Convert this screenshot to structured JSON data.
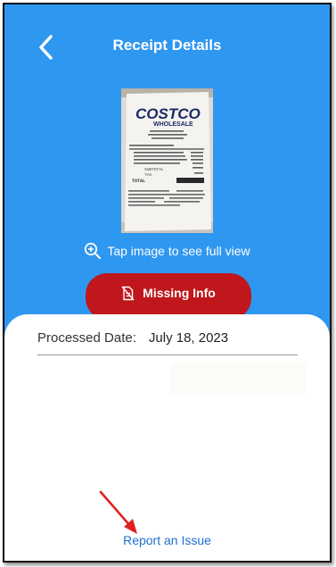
{
  "header": {
    "title": "Receipt Details",
    "back_icon": "chevron-left-icon"
  },
  "receipt": {
    "store": "COSTCO",
    "store_sub": "WHOLESALE",
    "total_label": "TOTAL",
    "subtotal_label": "SUBTOTAL",
    "tax_label": "TAX"
  },
  "image_hint": {
    "icon": "zoom-in-icon",
    "text": "Tap image to see full view"
  },
  "status_button": {
    "icon": "missing-file-icon",
    "label": "Missing Info",
    "color": "#c0171c"
  },
  "details": {
    "processed_date_label": "Processed Date:",
    "processed_date_value": "July 18, 2023"
  },
  "footer": {
    "report_link": "Report an Issue"
  },
  "colors": {
    "primary": "#2e97f0",
    "danger": "#c0171c",
    "link": "#1f6fd1",
    "annotation_arrow": "#e02020"
  }
}
